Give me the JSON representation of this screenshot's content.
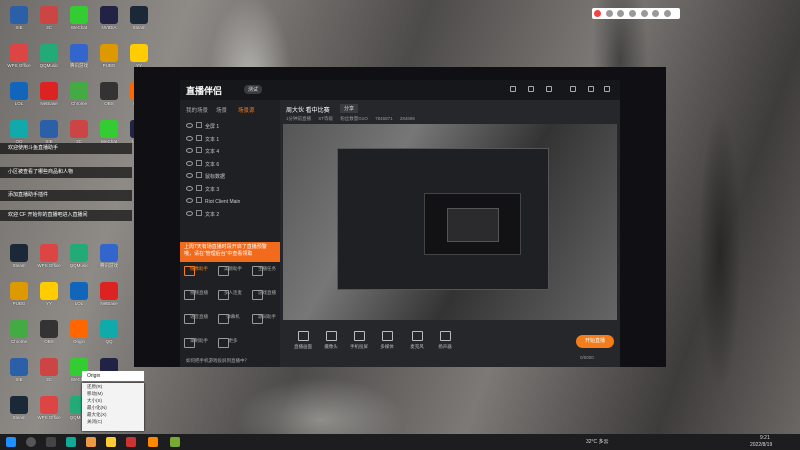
{
  "desktop": {
    "icons": [
      {
        "label": "SIE",
        "color": "#2b5fa8"
      },
      {
        "label": "3C",
        "color": "#c44"
      },
      {
        "label": "WeChat",
        "color": "#3c3"
      },
      {
        "label": "NVIDIA",
        "color": "#224"
      },
      {
        "label": "Steam",
        "color": "#1b2838"
      },
      {
        "label": "WPS Office",
        "color": "#d44"
      },
      {
        "label": "QQMusic",
        "color": "#2a7"
      },
      {
        "label": "腾讯游戏",
        "color": "#36c"
      },
      {
        "label": "PUBG",
        "color": "#d90"
      },
      {
        "label": "YY",
        "color": "#fc0"
      },
      {
        "label": "LOL",
        "color": "#16b"
      },
      {
        "label": "NetEase",
        "color": "#d22"
      },
      {
        "label": "Chrome",
        "color": "#4a4"
      },
      {
        "label": "OBS",
        "color": "#333"
      },
      {
        "label": "Origin",
        "color": "#f60"
      },
      {
        "label": "QQ",
        "color": "#1aa"
      }
    ],
    "notifications": [
      "欢迎使用斗鱼直播助手",
      "小区被查看了哪些商品和人物",
      "添加直播助手插件",
      "欢迎 CF 开始你的直播吧进入直播间"
    ]
  },
  "app": {
    "name": "直播伴侣",
    "version": "测试",
    "left_tabs": [
      "我的场景",
      "场景",
      "场景源"
    ],
    "scenes": [
      "全屏 1",
      "文本 1",
      "文本 4",
      "文本 6",
      "鼠标数据",
      "文本 3",
      "Riot Client Main",
      "文本 2"
    ],
    "banner_text": "上周7天有场直播时段开启了直播预警哦，请在“管理后台”中查看领取",
    "tools": [
      "摄像助手",
      "美颜助手",
      "主播任务",
      "视频直播",
      "多人连麦",
      "游戏直播",
      "语音直播",
      "弹幕机",
      "歌词助手",
      "录制助手",
      "更多"
    ],
    "hint": "如何把手机游戏投屏到直播中？",
    "room": {
      "title": "周大伙 看中比赛",
      "tag": "分享",
      "stats": [
        "1分钟前直播",
        "ST等级",
        "粉丝数量GoO",
        "7846871",
        "284696"
      ]
    },
    "bottom_actions": [
      "直播画面",
      "摄像头",
      "手机投屏",
      "多媒体",
      "麦克风",
      "扬声器"
    ],
    "go_live": "开始直播",
    "footer_stat": "0/5000"
  },
  "popup": {
    "title": "Origin",
    "items": [
      "还原(R)",
      "移动(M)",
      "大小(S)",
      "最小化(N)",
      "最大化(X)",
      "关闭(C)"
    ]
  },
  "taskbar": {
    "weather": "32°C 多云",
    "time": "9:21",
    "date": "2022/8/19"
  }
}
